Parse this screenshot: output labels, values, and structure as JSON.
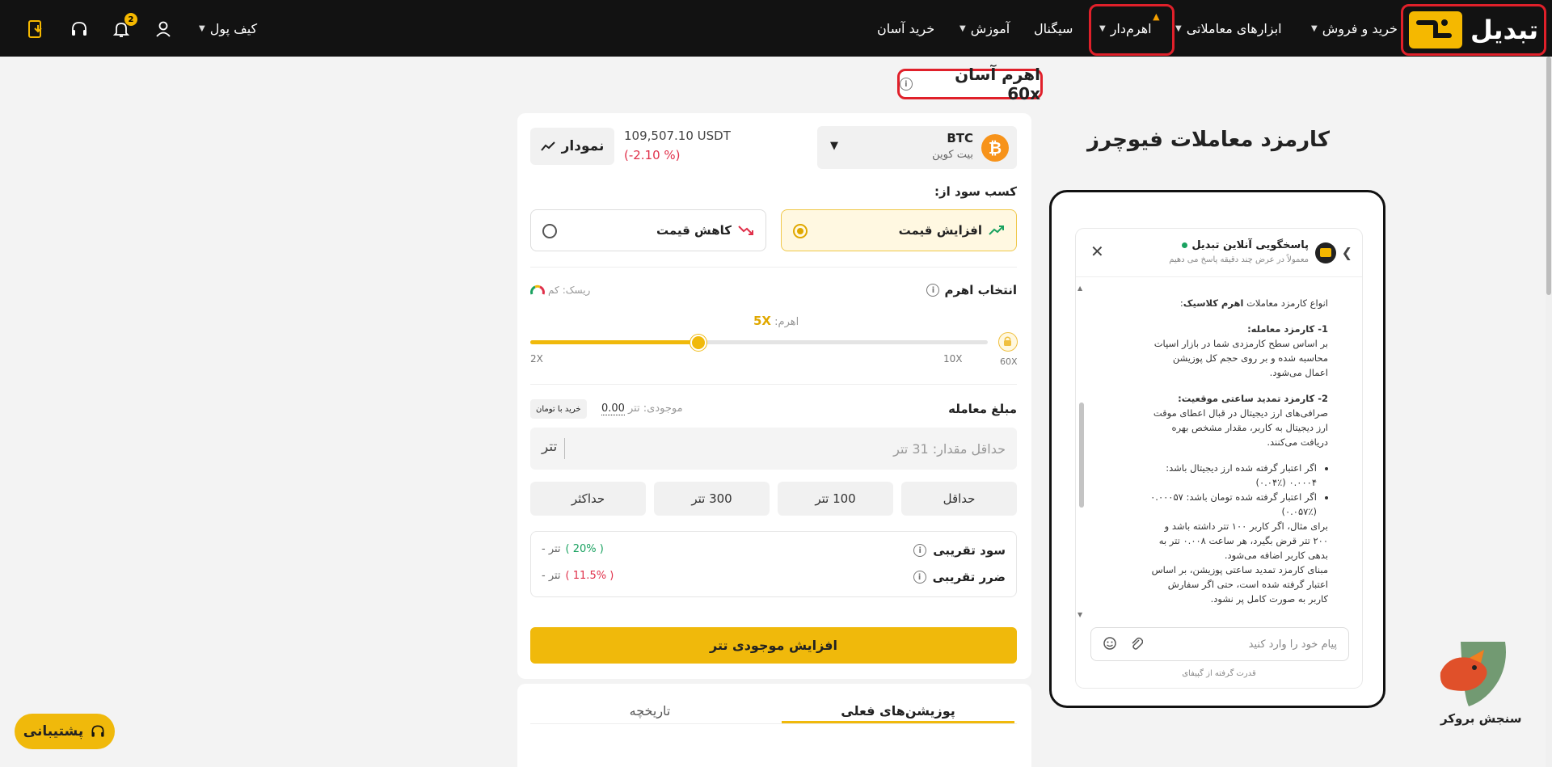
{
  "nav": {
    "logo": "تبدیل",
    "buy_sell": "خرید و فروش",
    "trading_tools": "ابزارهای معاملاتی",
    "leverage": "اهرم‌دار",
    "signal": "سیگنال",
    "education": "آموزش",
    "easy_buy": "خرید آسان",
    "wallet": "کیف پول",
    "notification_count": "2"
  },
  "header": {
    "title": "اهرم آسان 60x"
  },
  "pair": {
    "symbol": "BTC",
    "name": "بیت کوین",
    "price": "109,507.10",
    "quote": "USDT",
    "change": "(-2.10 %)",
    "chart_button": "نمودار"
  },
  "direction": {
    "label": "کسب سود از:",
    "up": "افزایش قیمت",
    "down": "کاهش قیمت",
    "selected": "up"
  },
  "leverage": {
    "label": "انتخاب اهرم",
    "risk_label": "ریسک:",
    "risk_value": "کم",
    "current_label": "اهرم:",
    "current_value": "5X",
    "min": "2X",
    "mid": "10X",
    "max": "60X",
    "level": 0.368
  },
  "amount": {
    "label": "مبلغ معامله",
    "balance_label": "موجودی: تتر",
    "balance_value": "0.00",
    "buy_toman": "خرید با تومان",
    "placeholder": "حداقل مقدار: 31 تتر",
    "unit": "تتر",
    "quick": [
      "حداقل",
      "100 تتر",
      "300 تتر",
      "حداکثر"
    ]
  },
  "estimate": {
    "profit_label": "سود تقریبی",
    "profit_percent": "( 20% )",
    "profit_value": "تتر -",
    "loss_label": "ضرر تقریبی",
    "loss_percent": "( 11.5% )",
    "loss_value": "تتر -"
  },
  "cta": {
    "label": "افزایش موجودی تتر"
  },
  "tabs": {
    "current": "پوزیشن‌های فعلی",
    "history": "تاریخچه"
  },
  "side": {
    "title": "کارمزد معاملات فیوچرز"
  },
  "chat": {
    "title": "پاسخگویی آنلاین تبدیل",
    "subtitle": "معمولاً در عرض چند دقیقه پاسخ می دهیم",
    "intro_prefix": "انواع کارمزد معاملات ",
    "intro_bold": "اهرم کلاسیک",
    "intro_suffix": ":",
    "s1_title": "1- کارمزد معامله:",
    "s1_body": "بر اساس سطح کارمزدی شما در بازار اسپات محاسبه شده و بر روی حجم کل پوزیشن اعمال می‌شود.",
    "s2_title": "2- کارمزد تمدید ساعتی موقعیت:",
    "s2_body": "صرافی‌های ارز دیجیتال در قبال اعطای موقت ارز دیجیتال به کاربر، مقدار مشخص بهره دریافت می‌کنند.",
    "bullet1": "اگر اعتبار گرفته شده ارز دیجیتال باشد: ۰.۰۰۰۴ (٪۰.۰۴)",
    "bullet2": "اگر اعتبار گرفته شده تومان باشد: ۰.۰۰۰۵۷ (٪۰.۰۵۷)",
    "example": "برای مثال، اگر کاربر ۱۰۰ تتر داشته باشد و ۲۰۰ تتر قرض بگیرد، هر ساعت ۰.۰۰۸ تتر به بدهی کاربر اضافه می‌شود.",
    "basis": "مبنای کارمزد تمدید ساعتی پوزیشن، بر اساس اعتبار گرفته شده است، حتی اگر سفارش کاربر به صورت کامل پر نشود.",
    "input_placeholder": "پیام خود را وارد کنید",
    "powered": "قدرت گرفته از گپیفای"
  },
  "watermark": {
    "text": "سنجش بروکر"
  },
  "support": {
    "label": "پشتیبانی"
  },
  "colors": {
    "brand": "#f0b90b",
    "nav_bg": "#121212",
    "highlight": "#e0202a",
    "up": "#1aa260",
    "down": "#e0304a"
  }
}
